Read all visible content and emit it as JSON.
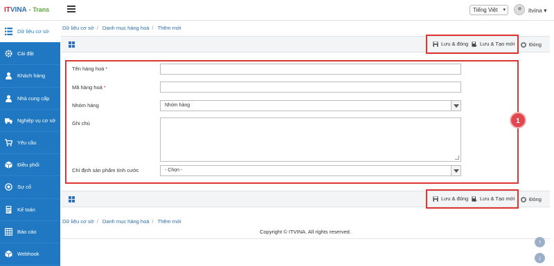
{
  "header": {
    "logo_part1": "IT",
    "logo_part2": "VINA",
    "logo_part3": "- Trans",
    "language": "Tiếng Việt",
    "user": "itvina"
  },
  "sidebar": {
    "items": [
      {
        "label": "Dữ liệu cơ sở",
        "icon": "list-icon"
      },
      {
        "label": "Cài đặt",
        "icon": "gear-icon"
      },
      {
        "label": "Khách hàng",
        "icon": "user-icon"
      },
      {
        "label": "Nhà cung cấp",
        "icon": "users-icon"
      },
      {
        "label": "Nghiệp vụ cơ sở",
        "icon": "truck-icon"
      },
      {
        "label": "Yêu cầu",
        "icon": "cart-icon"
      },
      {
        "label": "Điều phối",
        "icon": "cube-icon"
      },
      {
        "label": "Sự cố",
        "icon": "target-icon"
      },
      {
        "label": "Kế toán",
        "icon": "calculator-icon"
      },
      {
        "label": "Báo cáo",
        "icon": "table-icon"
      },
      {
        "label": "Webhook",
        "icon": "cube-icon"
      }
    ]
  },
  "breadcrumb": [
    "Dữ liệu cơ sở",
    "Danh mục hàng hoá",
    "Thêm mới"
  ],
  "toolbar": {
    "save_close": "Lưu & đóng",
    "save_new": "Lưu & Tạo mới",
    "close": "Đóng"
  },
  "form": {
    "name_label": "Tên hàng hoá",
    "code_label": "Mã hàng hoá",
    "group_label": "Nhóm hàng",
    "group_value": "Nhóm hàng",
    "note_label": "Ghi chú",
    "pricing_label": "Chỉ định sản phẩm tính cước",
    "pricing_value": "- Chọn -",
    "required_mark": "*"
  },
  "badge": "1",
  "footer": "Copyright © ITVINA. All rights reserved.",
  "colors": {
    "sidebar": "#1f78c1",
    "highlight": "#dd3333",
    "badge": "#e0484f"
  }
}
